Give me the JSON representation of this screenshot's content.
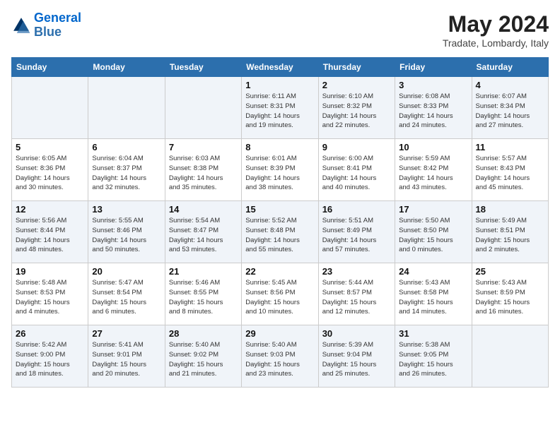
{
  "header": {
    "logo_line1": "General",
    "logo_line2": "Blue",
    "month": "May 2024",
    "location": "Tradate, Lombardy, Italy"
  },
  "days_of_week": [
    "Sunday",
    "Monday",
    "Tuesday",
    "Wednesday",
    "Thursday",
    "Friday",
    "Saturday"
  ],
  "weeks": [
    [
      {
        "num": "",
        "info": ""
      },
      {
        "num": "",
        "info": ""
      },
      {
        "num": "",
        "info": ""
      },
      {
        "num": "1",
        "info": "Sunrise: 6:11 AM\nSunset: 8:31 PM\nDaylight: 14 hours\nand 19 minutes."
      },
      {
        "num": "2",
        "info": "Sunrise: 6:10 AM\nSunset: 8:32 PM\nDaylight: 14 hours\nand 22 minutes."
      },
      {
        "num": "3",
        "info": "Sunrise: 6:08 AM\nSunset: 8:33 PM\nDaylight: 14 hours\nand 24 minutes."
      },
      {
        "num": "4",
        "info": "Sunrise: 6:07 AM\nSunset: 8:34 PM\nDaylight: 14 hours\nand 27 minutes."
      }
    ],
    [
      {
        "num": "5",
        "info": "Sunrise: 6:05 AM\nSunset: 8:36 PM\nDaylight: 14 hours\nand 30 minutes."
      },
      {
        "num": "6",
        "info": "Sunrise: 6:04 AM\nSunset: 8:37 PM\nDaylight: 14 hours\nand 32 minutes."
      },
      {
        "num": "7",
        "info": "Sunrise: 6:03 AM\nSunset: 8:38 PM\nDaylight: 14 hours\nand 35 minutes."
      },
      {
        "num": "8",
        "info": "Sunrise: 6:01 AM\nSunset: 8:39 PM\nDaylight: 14 hours\nand 38 minutes."
      },
      {
        "num": "9",
        "info": "Sunrise: 6:00 AM\nSunset: 8:41 PM\nDaylight: 14 hours\nand 40 minutes."
      },
      {
        "num": "10",
        "info": "Sunrise: 5:59 AM\nSunset: 8:42 PM\nDaylight: 14 hours\nand 43 minutes."
      },
      {
        "num": "11",
        "info": "Sunrise: 5:57 AM\nSunset: 8:43 PM\nDaylight: 14 hours\nand 45 minutes."
      }
    ],
    [
      {
        "num": "12",
        "info": "Sunrise: 5:56 AM\nSunset: 8:44 PM\nDaylight: 14 hours\nand 48 minutes."
      },
      {
        "num": "13",
        "info": "Sunrise: 5:55 AM\nSunset: 8:46 PM\nDaylight: 14 hours\nand 50 minutes."
      },
      {
        "num": "14",
        "info": "Sunrise: 5:54 AM\nSunset: 8:47 PM\nDaylight: 14 hours\nand 53 minutes."
      },
      {
        "num": "15",
        "info": "Sunrise: 5:52 AM\nSunset: 8:48 PM\nDaylight: 14 hours\nand 55 minutes."
      },
      {
        "num": "16",
        "info": "Sunrise: 5:51 AM\nSunset: 8:49 PM\nDaylight: 14 hours\nand 57 minutes."
      },
      {
        "num": "17",
        "info": "Sunrise: 5:50 AM\nSunset: 8:50 PM\nDaylight: 15 hours\nand 0 minutes."
      },
      {
        "num": "18",
        "info": "Sunrise: 5:49 AM\nSunset: 8:51 PM\nDaylight: 15 hours\nand 2 minutes."
      }
    ],
    [
      {
        "num": "19",
        "info": "Sunrise: 5:48 AM\nSunset: 8:53 PM\nDaylight: 15 hours\nand 4 minutes."
      },
      {
        "num": "20",
        "info": "Sunrise: 5:47 AM\nSunset: 8:54 PM\nDaylight: 15 hours\nand 6 minutes."
      },
      {
        "num": "21",
        "info": "Sunrise: 5:46 AM\nSunset: 8:55 PM\nDaylight: 15 hours\nand 8 minutes."
      },
      {
        "num": "22",
        "info": "Sunrise: 5:45 AM\nSunset: 8:56 PM\nDaylight: 15 hours\nand 10 minutes."
      },
      {
        "num": "23",
        "info": "Sunrise: 5:44 AM\nSunset: 8:57 PM\nDaylight: 15 hours\nand 12 minutes."
      },
      {
        "num": "24",
        "info": "Sunrise: 5:43 AM\nSunset: 8:58 PM\nDaylight: 15 hours\nand 14 minutes."
      },
      {
        "num": "25",
        "info": "Sunrise: 5:43 AM\nSunset: 8:59 PM\nDaylight: 15 hours\nand 16 minutes."
      }
    ],
    [
      {
        "num": "26",
        "info": "Sunrise: 5:42 AM\nSunset: 9:00 PM\nDaylight: 15 hours\nand 18 minutes."
      },
      {
        "num": "27",
        "info": "Sunrise: 5:41 AM\nSunset: 9:01 PM\nDaylight: 15 hours\nand 20 minutes."
      },
      {
        "num": "28",
        "info": "Sunrise: 5:40 AM\nSunset: 9:02 PM\nDaylight: 15 hours\nand 21 minutes."
      },
      {
        "num": "29",
        "info": "Sunrise: 5:40 AM\nSunset: 9:03 PM\nDaylight: 15 hours\nand 23 minutes."
      },
      {
        "num": "30",
        "info": "Sunrise: 5:39 AM\nSunset: 9:04 PM\nDaylight: 15 hours\nand 25 minutes."
      },
      {
        "num": "31",
        "info": "Sunrise: 5:38 AM\nSunset: 9:05 PM\nDaylight: 15 hours\nand 26 minutes."
      },
      {
        "num": "",
        "info": ""
      }
    ]
  ]
}
